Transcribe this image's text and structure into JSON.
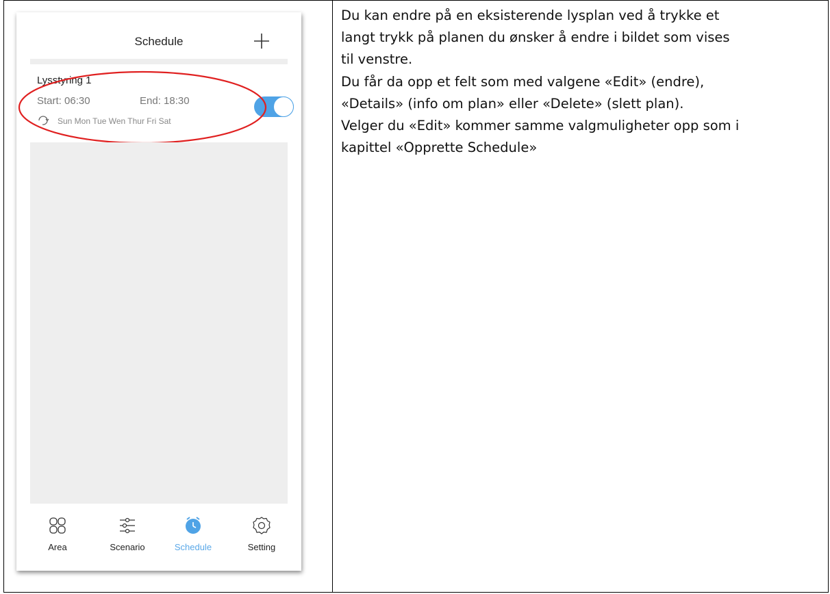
{
  "phone": {
    "title": "Schedule",
    "schedule_item": {
      "name": "Lysstyring 1",
      "start": "Start: 06:30",
      "end": "End: 18:30",
      "days": "Sun Mon Tue Wen Thur Fri Sat",
      "enabled": true
    },
    "highlight_color": "#e02020",
    "accent_color": "#4fa3e6",
    "tabs": [
      {
        "label": "Area",
        "icon": "grid-icon",
        "active": false
      },
      {
        "label": "Scenario",
        "icon": "sliders-icon",
        "active": false
      },
      {
        "label": "Schedule",
        "icon": "clock-icon",
        "active": true
      },
      {
        "label": "Setting",
        "icon": "gear-icon",
        "active": false
      }
    ]
  },
  "text": {
    "lines": [
      "Du kan endre på en eksisterende lysplan ved å trykke et",
      "langt trykk på planen du ønsker å endre i bildet som vises",
      "til venstre.",
      "Du får da opp et felt som med valgene «Edit» (endre),",
      "«Details» (info om plan» eller «Delete» (slett plan).",
      "Velger du «Edit» kommer samme valgmuligheter opp som i",
      "kapittel «Opprette Schedule»"
    ]
  }
}
